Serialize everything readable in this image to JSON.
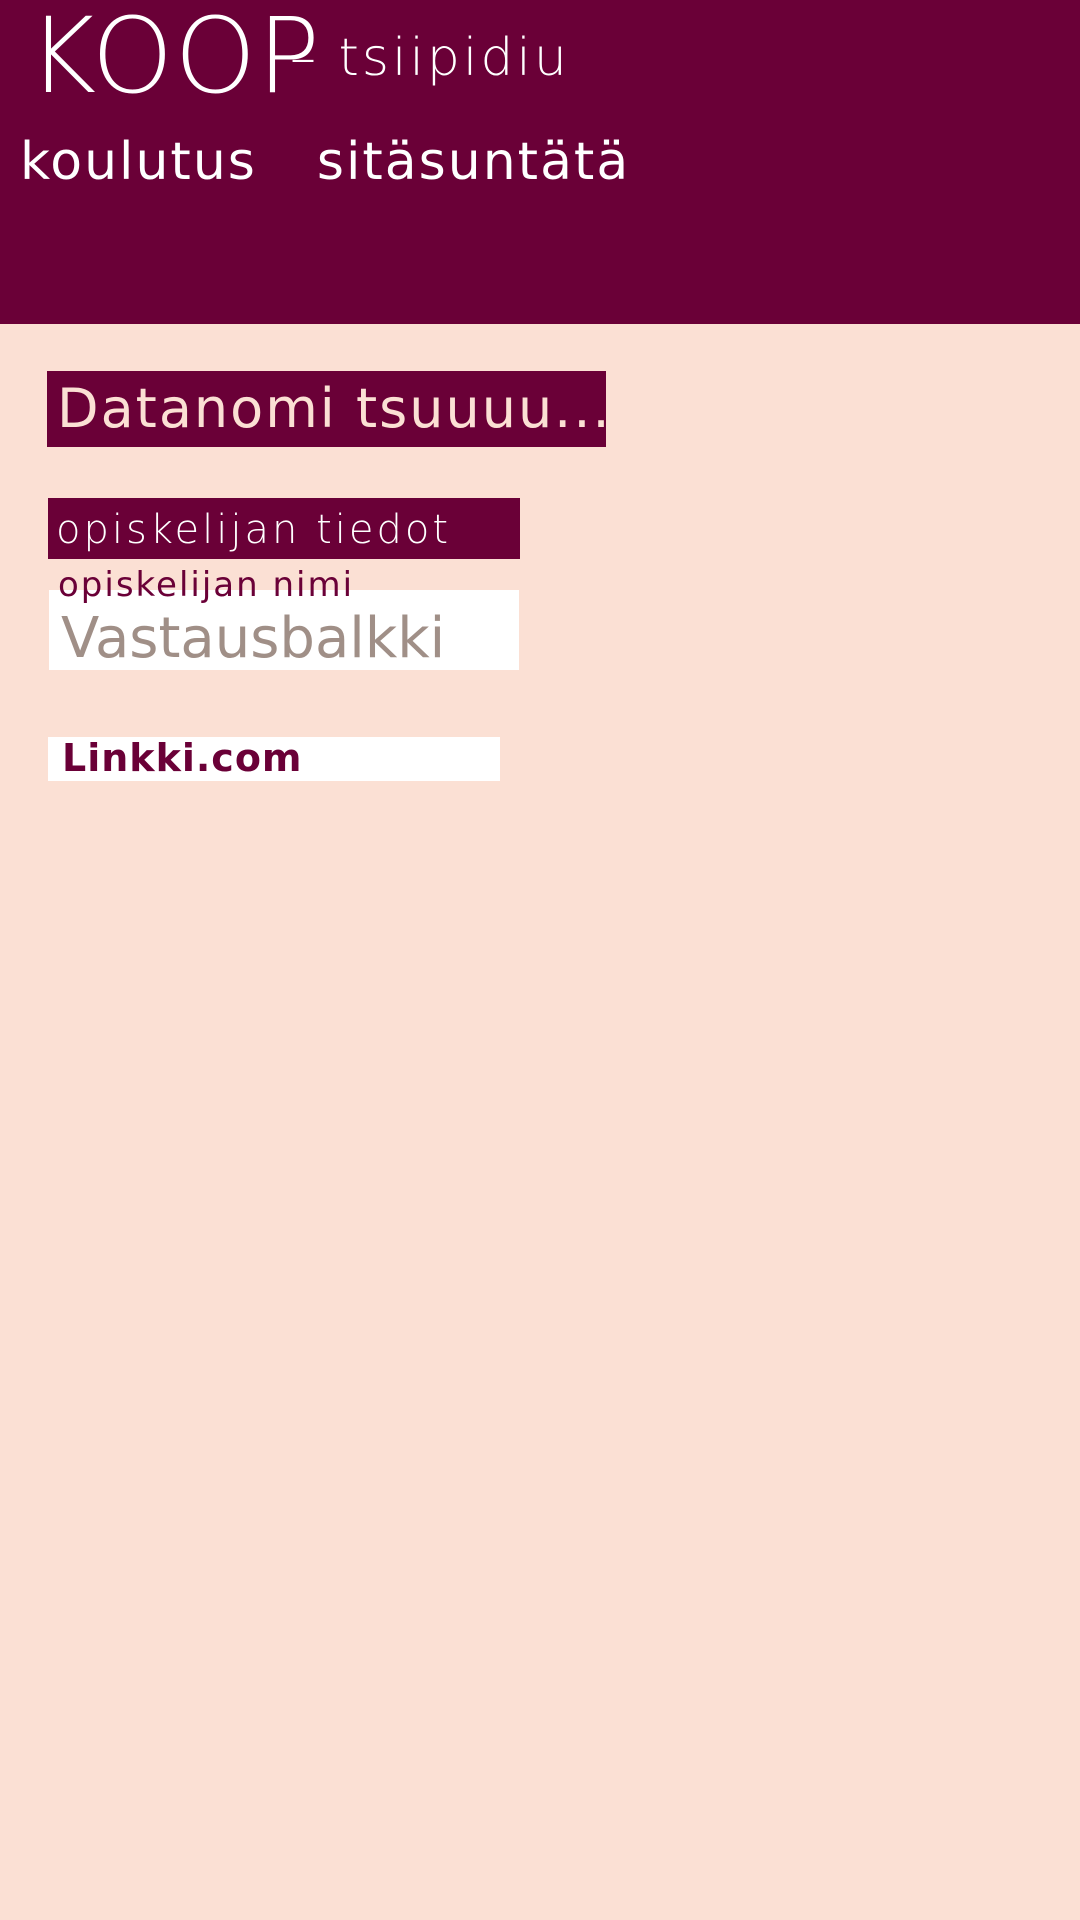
{
  "header": {
    "brand": "KOOP",
    "tagline": "– tsiipidiu",
    "nav": [
      {
        "label": "koulutus"
      },
      {
        "label": "sitäsuntätä"
      }
    ]
  },
  "main": {
    "page_title": "Datanomi tsuuuu...",
    "section_heading": "opiskelijan tiedot",
    "field": {
      "label": "opiskelijan nimi",
      "placeholder": "Vastausbalkki"
    },
    "link": {
      "text": "Linkki.com"
    }
  },
  "colors": {
    "primary": "#6A0037",
    "background": "#FBE0D4",
    "surface": "#FFFFFF",
    "placeholder": "#A08F87"
  }
}
